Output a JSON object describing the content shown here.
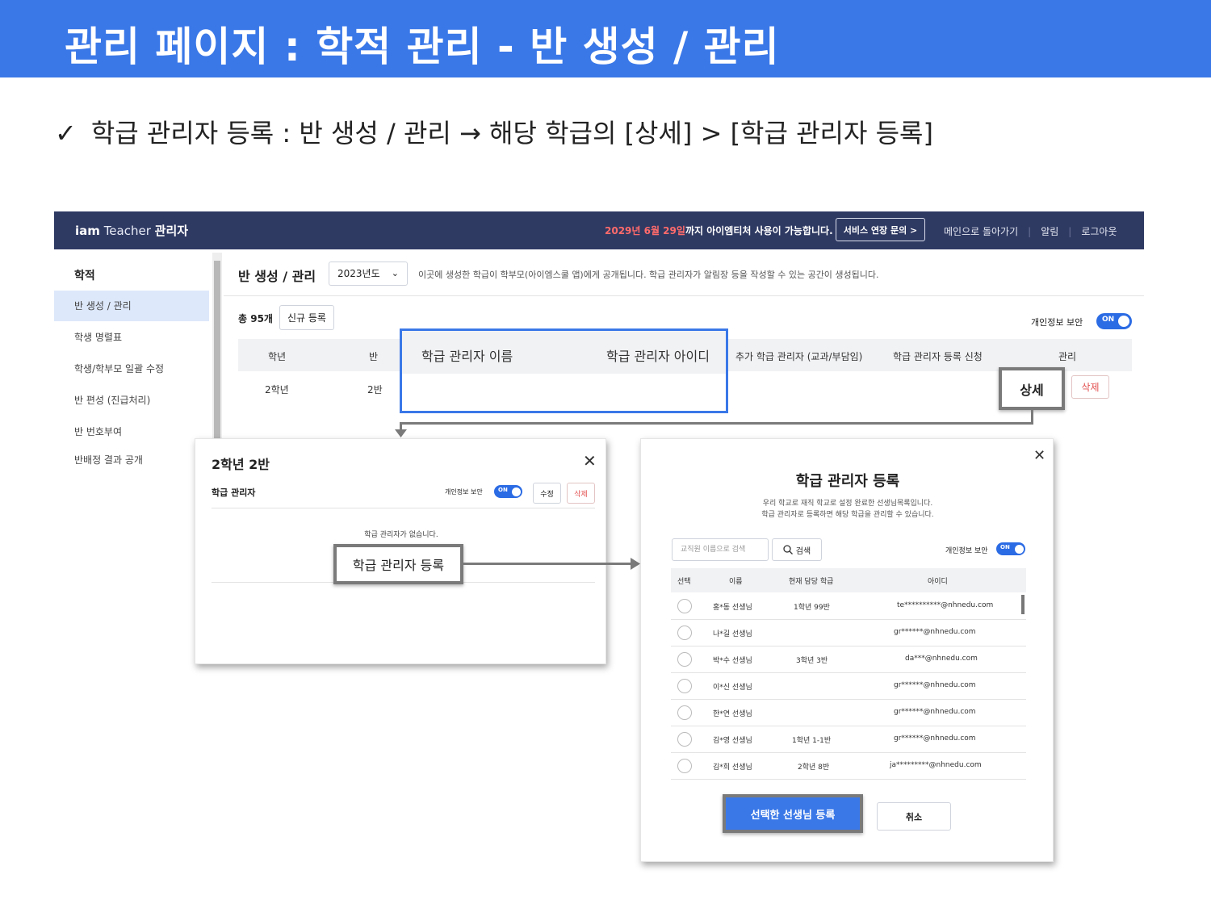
{
  "banner": {
    "title": "관리 페이지 : 학적 관리 - 반 생성 / 관리"
  },
  "instruction": {
    "check": "✓",
    "text": "학급 관리자 등록 : 반 생성 / 관리 → 해당 학급의 [상세] > [학급 관리자 등록]"
  },
  "topbar": {
    "logo_bold": "iam",
    "logo_light": "Teacher",
    "logo_suffix": "관리자",
    "notice_date": "2029년 6월 29일",
    "notice_rest": "까지 아이엠티처 사용이 가능합니다.",
    "service_button": "서비스 연장 문의 >",
    "links": [
      "메인으로 돌아가기",
      "알림",
      "로그아웃"
    ]
  },
  "sidebar": {
    "heading": "학적",
    "items": [
      "반 생성 / 관리",
      "학생 명렬표",
      "학생/학부모 일괄 수정",
      "반 편성 (진급처리)",
      "반 번호부여",
      "반배정 결과 공개"
    ],
    "active_index": 0
  },
  "content": {
    "title": "반 생성 / 관리",
    "year": "2023년도",
    "description": "이곳에 생성한 학급이 학부모(아이엠스쿨 앱)에게 공개됩니다. 학급 관리자가 알림장 등을 작성할 수 있는 공간이 생성됩니다.",
    "total": "총 95개",
    "new_button": "신규 등록",
    "privacy_label": "개인정보 보안",
    "toggle_on": "ON",
    "columns": [
      "학년",
      "반",
      "학급 관리자 이름",
      "학급 관리자 아이디",
      "추가 학급 관리자 (교과/부담임)",
      "학급 관리자 등록 신청",
      "관리"
    ],
    "row": {
      "grade": "2학년",
      "class": "2반"
    },
    "detail_button": "상세",
    "delete_button": "삭제"
  },
  "modal1": {
    "title": "2학년 2반",
    "close": "✕",
    "subtitle": "학급 관리자",
    "privacy_label": "개인정보 보안",
    "toggle_on": "ON",
    "edit": "수정",
    "delete": "삭제",
    "empty_text": "학급 관리자가 없습니다.",
    "register_button": "학급 관리자 등록"
  },
  "modal2": {
    "close": "✕",
    "title": "학급 관리자 등록",
    "desc_line1": "우리 학교로 재직 학교로 설정 완료한 선생님목록입니다.",
    "desc_line2": "학급 관리자로 등록하면 해당 학급을 관리할 수 있습니다.",
    "search_placeholder": "교직원 이름으로 검색",
    "search_button": "검색",
    "privacy_label": "개인정보 보안",
    "toggle_on": "ON",
    "columns": [
      "선택",
      "이름",
      "현재 담당 학급",
      "아이디"
    ],
    "rows": [
      {
        "name": "홍*동 선생님",
        "class": "1학년 99반",
        "id": "te**********@nhnedu.com"
      },
      {
        "name": "나*길 선생님",
        "class": "",
        "id": "gr******@nhnedu.com"
      },
      {
        "name": "박*수 선생님",
        "class": "3학년 3반",
        "id": "da***@nhnedu.com"
      },
      {
        "name": "이*신 선생님",
        "class": "",
        "id": "gr******@nhnedu.com"
      },
      {
        "name": "한*연 선생님",
        "class": "",
        "id": "gr******@nhnedu.com"
      },
      {
        "name": "김*영 선생님",
        "class": "1학년 1-1반",
        "id": "gr******@nhnedu.com"
      },
      {
        "name": "김*희 선생님",
        "class": "2학년 8반",
        "id": "ja*********@nhnedu.com"
      }
    ],
    "submit_button": "선택한 선생님 등록",
    "cancel_button": "취소"
  },
  "colors": {
    "accent": "#3a78e8",
    "topbar": "#2f3a63",
    "danger": "#e35050",
    "highlight_border": "#7a7a7a"
  }
}
